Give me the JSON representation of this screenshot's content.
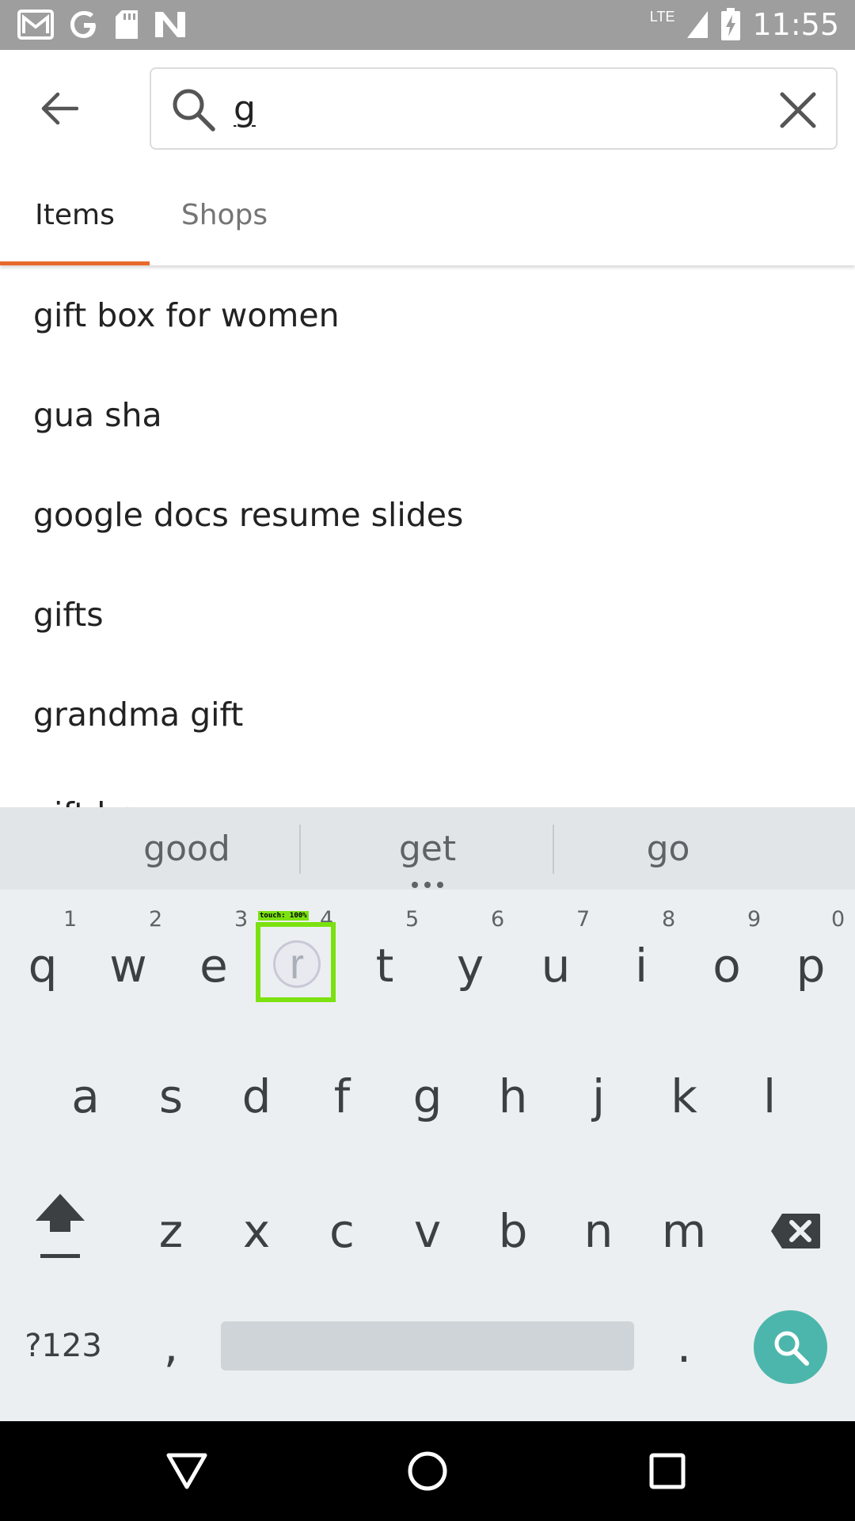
{
  "status_bar": {
    "time": "11:55",
    "network": "LTE",
    "icons": [
      "gmail-icon",
      "google-icon",
      "sd-card-icon",
      "n-icon",
      "signal-icon",
      "battery-charging-icon"
    ]
  },
  "header": {
    "back_icon": "arrow-back-icon",
    "search_query": "g",
    "search_icon": "search-icon",
    "clear_icon": "close-icon"
  },
  "tabs": [
    {
      "label": "Items",
      "active": true
    },
    {
      "label": "Shops",
      "active": false
    }
  ],
  "accent_color": "#e8692b",
  "suggestions": [
    "gift box for women",
    "gua sha",
    "google docs resume slides",
    "gifts",
    "grandma gift",
    "gift box"
  ],
  "keyboard": {
    "word_suggestions": [
      "good",
      "get",
      "go"
    ],
    "row1": [
      {
        "key": "q",
        "hint": "1"
      },
      {
        "key": "w",
        "hint": "2"
      },
      {
        "key": "e",
        "hint": "3"
      },
      {
        "key": "r",
        "hint": "4"
      },
      {
        "key": "t",
        "hint": "5"
      },
      {
        "key": "y",
        "hint": "6"
      },
      {
        "key": "u",
        "hint": "7"
      },
      {
        "key": "i",
        "hint": "8"
      },
      {
        "key": "o",
        "hint": "9"
      },
      {
        "key": "p",
        "hint": "0"
      }
    ],
    "row2": [
      "a",
      "s",
      "d",
      "f",
      "g",
      "h",
      "j",
      "k",
      "l"
    ],
    "row3": [
      "z",
      "x",
      "c",
      "v",
      "b",
      "n",
      "m"
    ],
    "symbols_label": "?123",
    "comma": ",",
    "period": ".",
    "pressed_key": "r",
    "touch_label": "touch: 100%",
    "action_color": "#4db6ac"
  },
  "nav_bar": {
    "icons": [
      "back-triangle-icon",
      "home-circle-icon",
      "recents-square-icon"
    ]
  }
}
